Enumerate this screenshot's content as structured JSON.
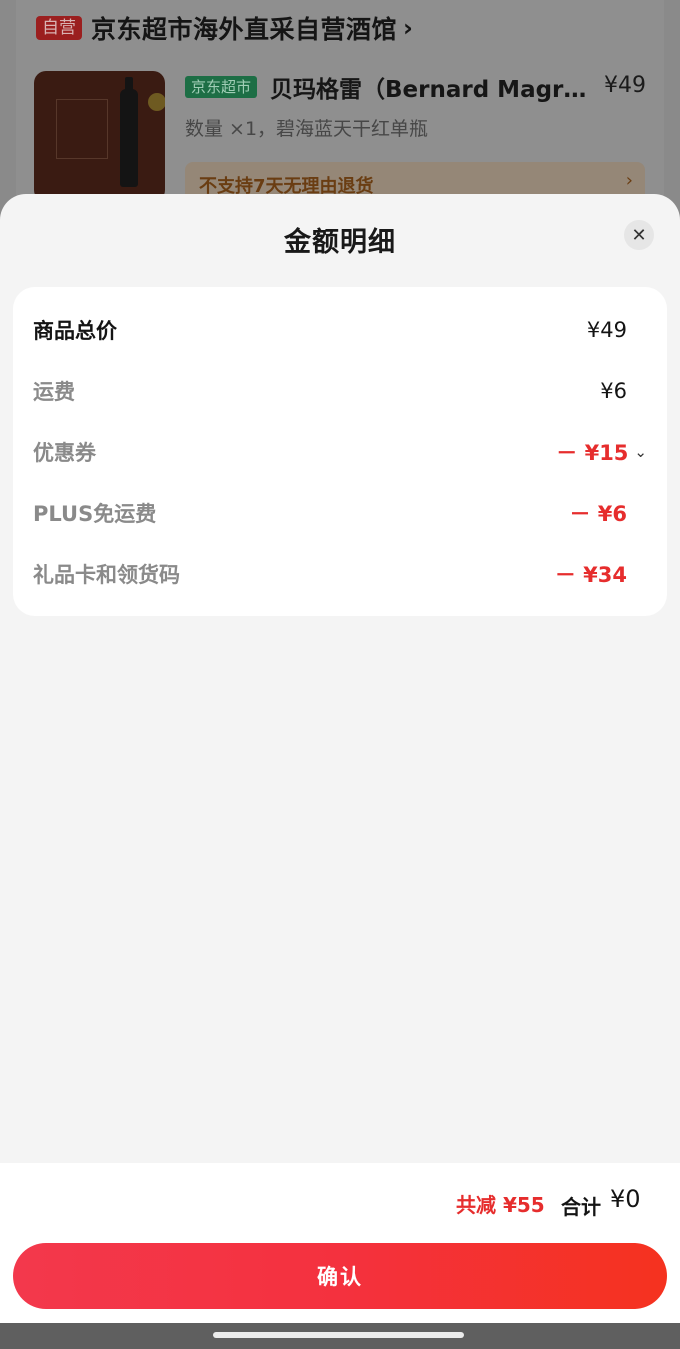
{
  "background": {
    "shop_badge": "自营",
    "shop_name": "京东超市海外直采自营酒馆",
    "product": {
      "tag": "京东超市",
      "title": "贝玛格雷（Bernard Magrez）碧海蓝天干红",
      "price": "¥49",
      "spec": "数量 ×1，碧海蓝天干红单瓶"
    },
    "return_notice": "不支持7天无理由退货"
  },
  "sheet": {
    "title": "金额明细",
    "rows": [
      {
        "label": "商品总价",
        "value": "¥49"
      },
      {
        "label": "运费",
        "value": "¥6"
      },
      {
        "label": "优惠券",
        "value": "－ ¥15"
      },
      {
        "label": "PLUS免运费",
        "value": "－ ¥6"
      },
      {
        "label": "礼品卡和领货码",
        "value": "－ ¥34"
      }
    ]
  },
  "footer": {
    "reduce_text": "共减 ¥55",
    "total_label": "合计",
    "total_value": "¥0",
    "confirm_label": "确认"
  },
  "colors": {
    "accent_red": "#e62d2d",
    "button_gradient_start": "#f3384c",
    "button_gradient_end": "#f5321f"
  },
  "icons": {
    "close": "close-icon",
    "chevron_right": "chevron-right-icon",
    "chevron_down": "chevron-down-icon"
  }
}
